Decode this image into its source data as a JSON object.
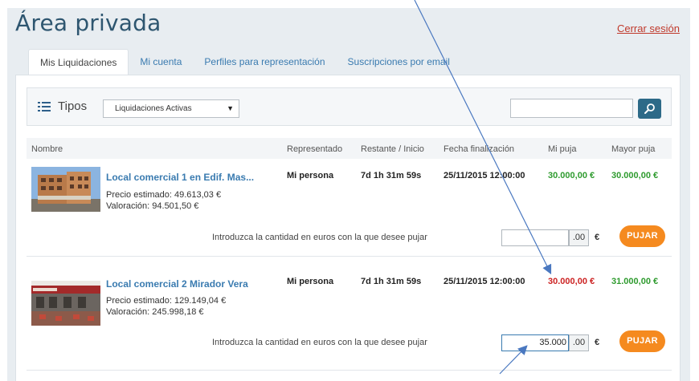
{
  "header": {
    "title": "Área privada",
    "logout_label": "Cerrar sesión"
  },
  "tabs": [
    {
      "label": "Mis Liquidaciones",
      "active": true
    },
    {
      "label": "Mi cuenta",
      "active": false
    },
    {
      "label": "Perfiles para representación",
      "active": false
    },
    {
      "label": "Suscripciones por email",
      "active": false
    }
  ],
  "filter": {
    "label": "Tipos",
    "selected": "Liquidaciones Activas",
    "search_value": ""
  },
  "table": {
    "columns": [
      "Nombre",
      "Representado",
      "Restante / Inicio",
      "Fecha finalización",
      "Mi puja",
      "Mayor puja"
    ],
    "rows": [
      {
        "title": "Local comercial 1 en Edif. Mas...",
        "estimated_price": "Precio estimado: 49.613,03 €",
        "valuation": "Valoración: 94.501,50 €",
        "represented": "Mi persona",
        "remaining": "7d 1h 31m 59s",
        "end_date": "25/11/2015 12:00:00",
        "my_bid": "30.000,00 €",
        "my_bid_status": "winning",
        "top_bid": "30.000,00 €",
        "bid_prompt": "Introduzca la cantidad en euros con la que desee pujar",
        "bid_value": "",
        "cents": ".00",
        "currency": "€",
        "bid_button": "PUJAR"
      },
      {
        "title": "Local comercial 2 Mirador Vera",
        "estimated_price": "Precio estimado: 129.149,04 €",
        "valuation": "Valoración: 245.998,18 €",
        "represented": "Mi persona",
        "remaining": "7d 1h 31m 59s",
        "end_date": "25/11/2015 12:00:00",
        "my_bid": "30.000,00 €",
        "my_bid_status": "outbid",
        "top_bid": "31.000,00 €",
        "bid_prompt": "Introduzca la cantidad en euros con la que desee pujar",
        "bid_value": "35.000",
        "cents": ".00",
        "currency": "€",
        "bid_button": "PUJAR"
      }
    ]
  },
  "colors": {
    "title": "#2e5670",
    "link": "#3a7bb0",
    "bid_winning": "#2e9b2e",
    "bid_outbid": "#cc2222",
    "bid_button": "#f58a1f",
    "search_button": "#2d6a88",
    "annotation_arrow": "#4a78c0"
  },
  "icons": {
    "list": "list-icon",
    "search": "search-icon",
    "dropdown": "chevron-down-icon"
  }
}
